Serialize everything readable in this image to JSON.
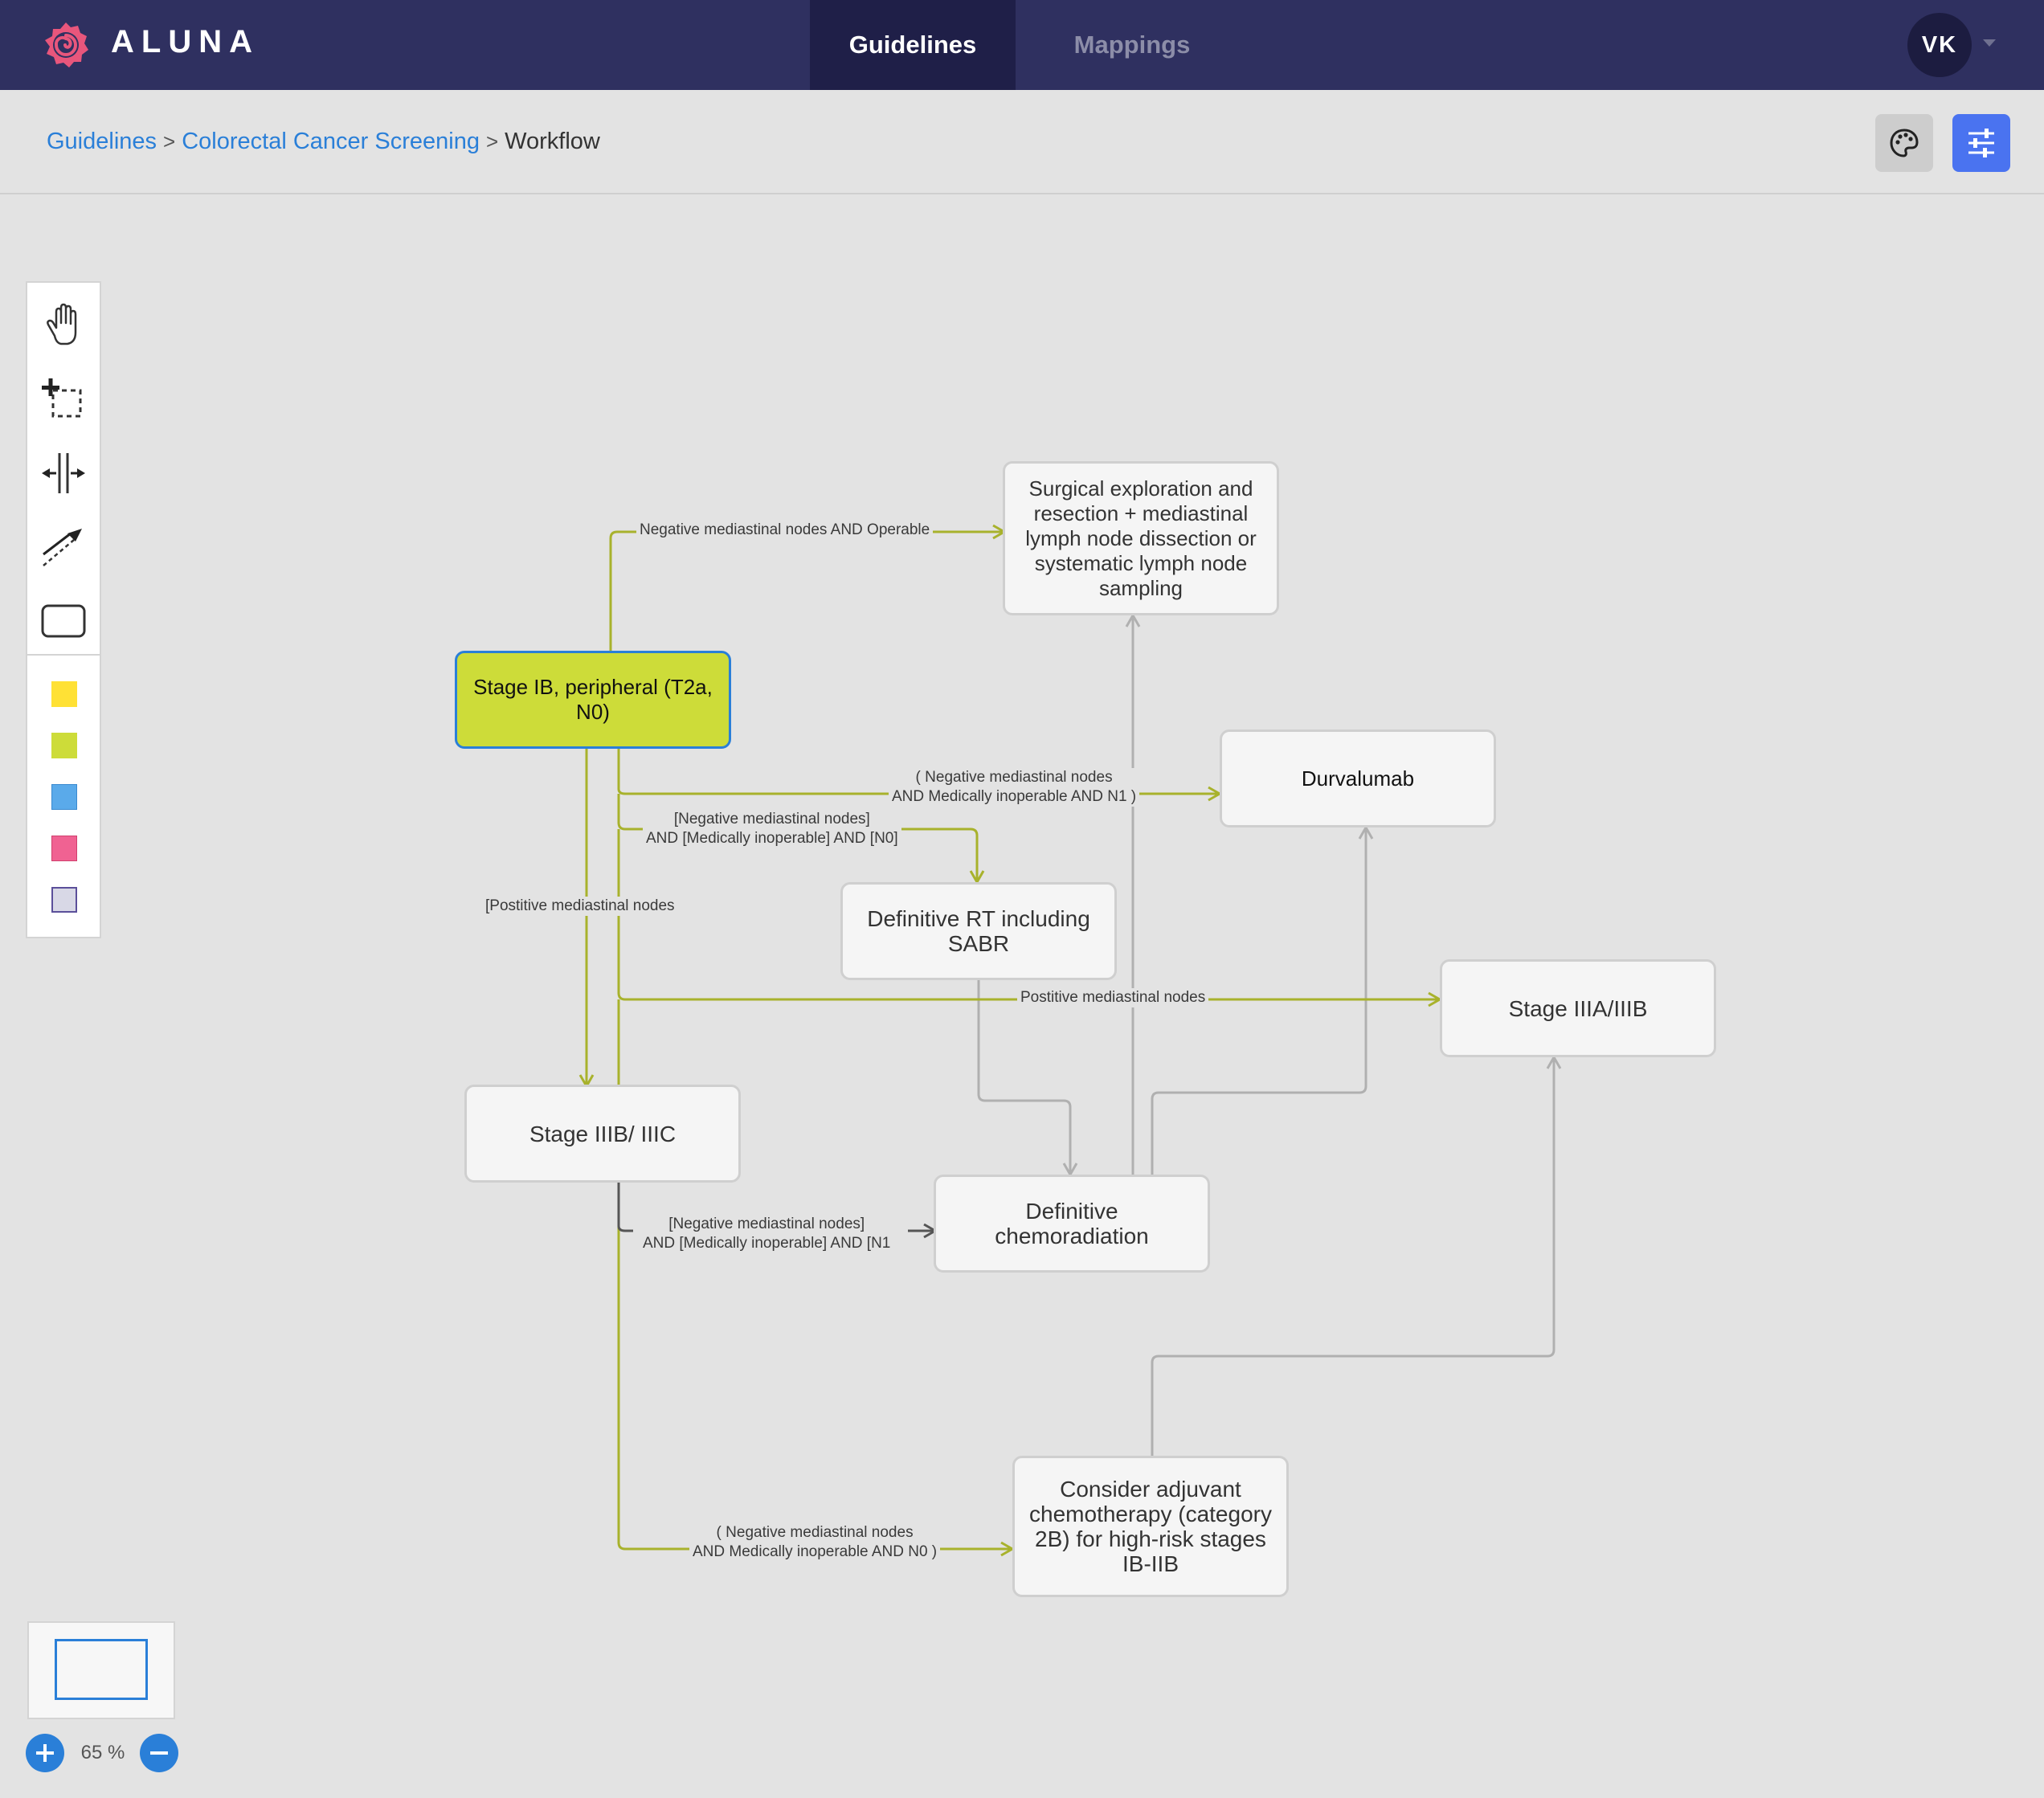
{
  "app": {
    "brand": "ALUNA"
  },
  "nav": {
    "tabs": [
      {
        "label": "Guidelines",
        "active": true
      },
      {
        "label": "Mappings",
        "active": false
      }
    ]
  },
  "user": {
    "initials": "VK"
  },
  "breadcrumb": {
    "items": [
      "Guidelines",
      "Colorectal Cancer Screening",
      "Workflow"
    ],
    "separator": ">"
  },
  "toolbar": {
    "icons": [
      "palette-icon",
      "sliders-icon"
    ]
  },
  "tools": {
    "icons": [
      "hand-pan-icon",
      "marquee-select-icon",
      "split-resize-icon",
      "connector-arrow-icon",
      "rectangle-node-icon"
    ]
  },
  "palette": {
    "swatches": [
      "#ffe135",
      "#cddc39",
      "#5aaaea",
      "#f06292",
      "#d8d8e6"
    ]
  },
  "workflow": {
    "nodes": {
      "surgical": "Surgical exploration and resection + mediastinal lymph node dissection or systematic lymph node sampling",
      "stage_ib": "Stage IB, peripheral (T2a, N0)",
      "durvalumab": "Durvalumab",
      "definitive_rt": "Definitive RT including SABR",
      "stage_iiia": "Stage IIIA/IIIB",
      "stage_iiib": "Stage IIIB/ IIIC",
      "chemoradiation": "Definitive chemoradiation",
      "adjuvant": "Consider adjuvant chemotherapy (category 2B) for high-risk stages IB-IIB"
    },
    "edges": {
      "neg_operable": "Negative mediastinal nodes AND Operable",
      "neg_inop_n1": [
        "( Negative mediastinal nodes",
        "AND Medically inoperable AND N1 )"
      ],
      "neg_inop_n0": [
        "[Negative mediastinal nodes]",
        "AND [Medically inoperable] AND [N0]"
      ],
      "pos_left": "[Postitive mediastinal nodes",
      "pos_right": "Postitive mediastinal nodes",
      "neg_inop_n1_b": [
        "[Negative mediastinal nodes]",
        "AND [Medically inoperable] AND [N1"
      ],
      "neg_inop_n0_b": [
        "( Negative mediastinal nodes",
        "AND Medically inoperable AND N0 )"
      ]
    },
    "colors": {
      "selected_fill": "#cddc39",
      "edge_active": "#a8b22c",
      "edge_inactive": "#b0b0b0",
      "accent": "#2a7fd8"
    }
  },
  "zoom": {
    "level": "65 %"
  }
}
